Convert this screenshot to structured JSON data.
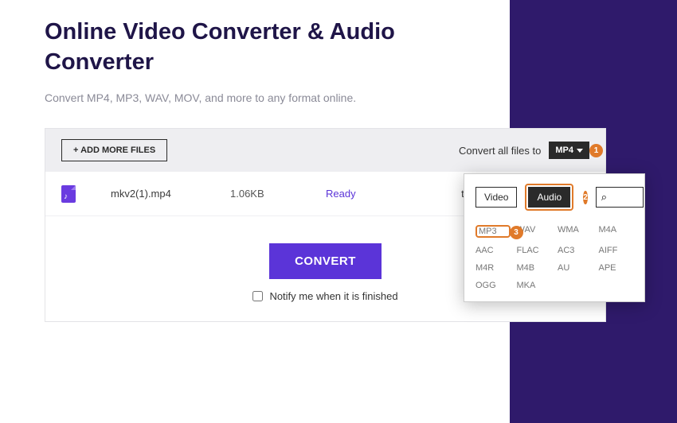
{
  "page": {
    "title": "Online Video Converter & Audio Converter",
    "subtitle": "Convert MP4, MP3, WAV, MOV, and more to any format online."
  },
  "toolbar": {
    "add_more": "+ ADD MORE FILES",
    "convert_all_label": "Convert all files to",
    "format_selected": "MP4"
  },
  "file": {
    "name": "mkv2(1).mp4",
    "size": "1.06KB",
    "status": "Ready",
    "to_label": "to"
  },
  "actions": {
    "convert": "CONVERT",
    "notify_label": "Notify me when it is finished"
  },
  "dropdown": {
    "tab_video": "Video",
    "tab_audio": "Audio",
    "search_placeholder": "",
    "search_icon": "⌕",
    "formats": [
      "MP3",
      "WAV",
      "WMA",
      "M4A",
      "AAC",
      "FLAC",
      "AC3",
      "AIFF",
      "M4R",
      "M4B",
      "AU",
      "APE",
      "OGG",
      "MKA"
    ]
  },
  "annotations": {
    "a1": "1",
    "a2": "2",
    "a3": "3"
  }
}
